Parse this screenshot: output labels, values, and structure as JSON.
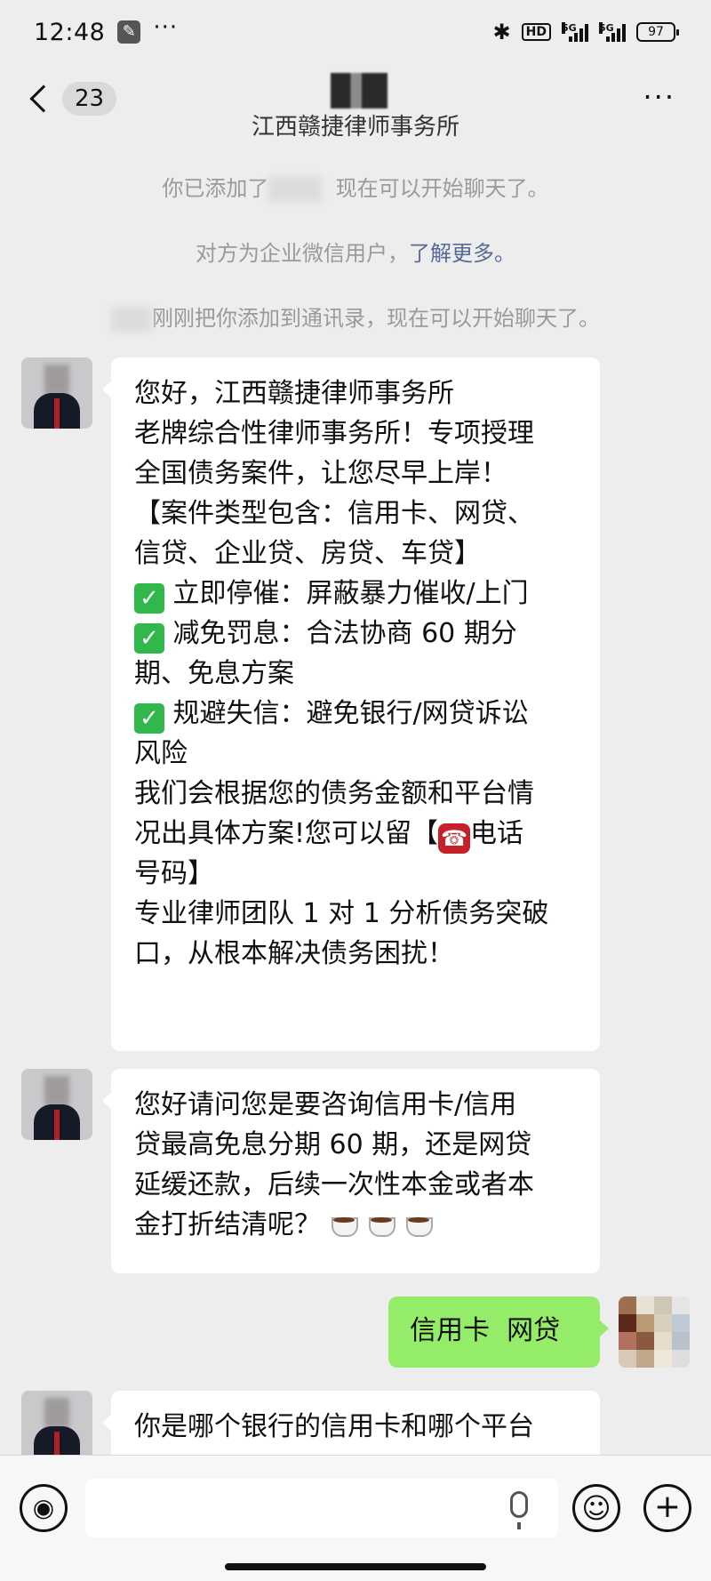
{
  "status_bar": {
    "time": "12:48",
    "more": "···",
    "bluetooth": "✱",
    "hd": "HD",
    "signal1_label": "5G",
    "signal2_label": "5G",
    "battery": "97"
  },
  "header": {
    "unread_count": "23",
    "company": "江西赣捷律师事务所",
    "more": "···"
  },
  "system_messages": {
    "added_prefix": "你已添加了",
    "added_suffix": "现在可以开始聊天了。",
    "enterprise_text": "对方为企业微信用户，",
    "learn_more": "了解更多。",
    "contact_added": "刚刚把你添加到通讯录，现在可以开始聊天了。"
  },
  "messages": [
    {
      "lines": [
        "您好，江西赣捷律师事务所",
        "老牌综合性律师事务所！专项授理",
        "全国债务案件，让您尽早上岸！",
        "【案件类型包含：信用卡、网贷、",
        "信贷、企业贷、房贷、车贷】",
        "立即停催：屏蔽暴力催收/上门",
        "减免罚息：合法协商 60 期分",
        "期、免息方案",
        "规避失信：避免银行/网贷诉讼",
        "风险",
        "我们会根据您的债务金额和平台情",
        "况出具体方案!您可以留【",
        "电话",
        "号码】",
        "专业律师团队 1 对 1 分析债务突破",
        "口，从根本解决债务困扰！"
      ]
    },
    {
      "lines": [
        "您好请问您是要咨询信用卡/信用",
        "贷最高免息分期 60 期，还是网贷",
        "延缓还款，后续一次性本金或者本",
        "金打折结清呢？"
      ]
    },
    {
      "text": "信用卡  网贷"
    },
    {
      "text": "你是哪个银行的信用卡和哪个平台"
    }
  ],
  "icons": {
    "check": "✓",
    "phone": "☎",
    "voice": "◉",
    "emoji": "☺",
    "plus": "+"
  }
}
